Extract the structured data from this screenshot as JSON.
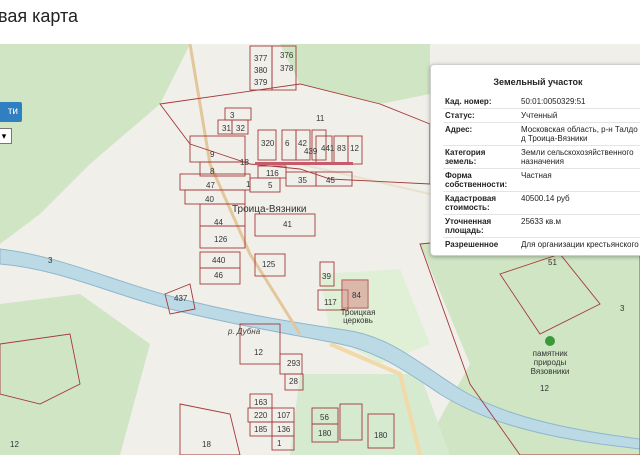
{
  "header": {
    "title": "вая карта"
  },
  "map": {
    "button_label": "ти",
    "select_value": "▾",
    "place_labels": [
      {
        "name": "troitsa-vyazniki",
        "text": "Троица-Вязники"
      },
      {
        "name": "troitsa-church",
        "text": "Троицкая церковь"
      },
      {
        "name": "river-dubna",
        "text": "р. Дубна"
      }
    ],
    "park_label": "памятник природы Вязовники",
    "parcel_numbers": [
      "376",
      "377",
      "380",
      "378",
      "379",
      "11",
      "3",
      "31",
      "32",
      "320",
      "6",
      "42",
      "439",
      "441",
      "83",
      "12",
      "9",
      "18",
      "116",
      "5",
      "35",
      "45",
      "1",
      "8",
      "47",
      "40",
      "44",
      "126",
      "41",
      "440",
      "46",
      "125",
      "437",
      "39",
      "117",
      "84",
      "3",
      "12",
      "293",
      "28",
      "163",
      "220",
      "185",
      "107",
      "136",
      "56",
      "1",
      "180",
      "180",
      "18",
      "51",
      "12",
      "12",
      "3"
    ]
  },
  "popup": {
    "title": "Земельный участок",
    "rows": [
      {
        "key": "Кад. номер:",
        "value": "50:01:0050329:51"
      },
      {
        "key": "Статус:",
        "value": "Учтенный"
      },
      {
        "key": "Адрес:",
        "value": "Московская область, р-н Талдо д Троица-Вязники"
      },
      {
        "key": "Категория земель:",
        "value": "Земли сельскохозяйственного назначения"
      },
      {
        "key": "Форма собственности:",
        "value": "Частная"
      },
      {
        "key": "Кадастровая стоимость:",
        "value": "40500.14 руб"
      },
      {
        "key": "Уточненная площадь:",
        "value": "25633 кв.м"
      },
      {
        "key": "Разрешенное",
        "value": "Для организации крестьянского"
      }
    ]
  },
  "colors": {
    "parcel_border": "#a33a3a",
    "forest": "#c8e2c0",
    "river": "#bcd9e6",
    "button": "#2f7fc1"
  }
}
